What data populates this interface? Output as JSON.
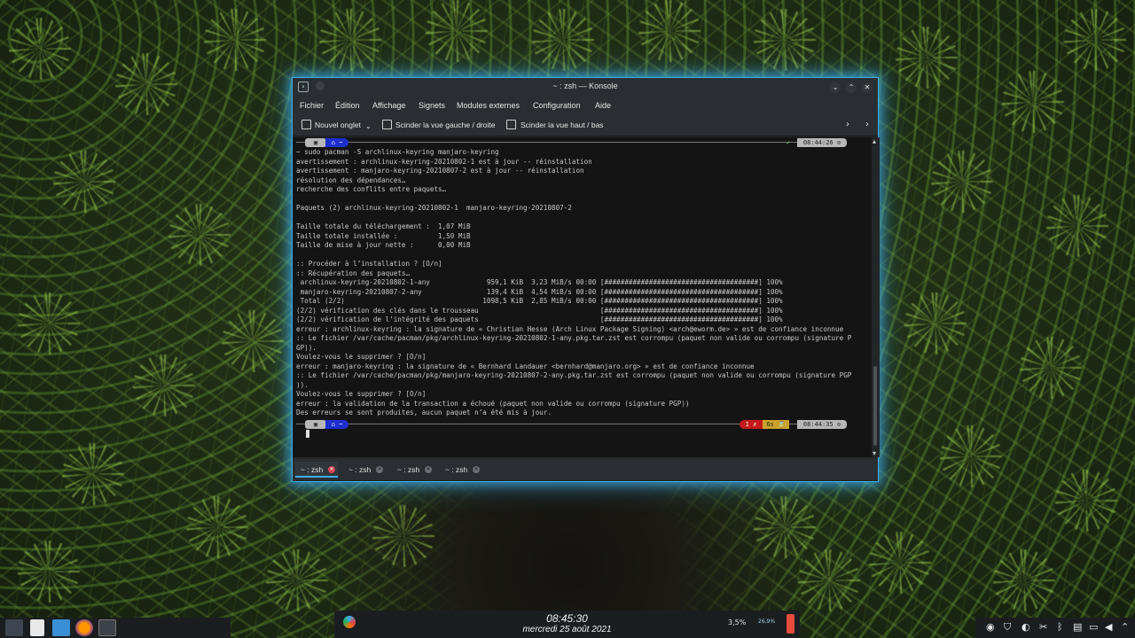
{
  "window": {
    "title": "~ : zsh — Konsole",
    "accent": "#3daee9"
  },
  "menubar": {
    "items": [
      "Fichier",
      "Édition",
      "Affichage",
      "Signets",
      "Modules externes",
      "Configuration",
      "Aide"
    ]
  },
  "toolbar": {
    "new_tab": "Nouvel onglet",
    "split_lr": "Scinder la vue gauche / droite",
    "split_tb": "Scinder la vue haut / bas"
  },
  "terminal": {
    "prompt_top": {
      "icon": "▣",
      "path": "⌂ ~",
      "check": "✓",
      "time": "08:44:26 ⊙"
    },
    "lines": [
      "~ sudo pacman -S archlinux-keyring manjaro-keyring",
      "avertissement : archlinux-keyring-20210802-1 est à jour -- réinstallation",
      "avertissement : manjaro-keyring-20210807-2 est à jour -- réinstallation",
      "résolution des dépendances…",
      "recherche des conflits entre paquets…",
      "",
      "Paquets (2) archlinux-keyring-20210802-1  manjaro-keyring-20210807-2",
      "",
      "Taille totale du téléchargement :  1,07 MiB",
      "Taille totale installée :          1,50 MiB",
      "Taille de mise à jour nette :      0,00 MiB",
      "",
      ":: Procéder à l’installation ? [O/n]",
      ":: Récupération des paquets…",
      " archlinux-keyring-20210802-1-any              959,1 KiB  3,23 MiB/s 00:00 [######################################] 100%",
      " manjaro-keyring-20210807-2-any                139,4 KiB  4,54 MiB/s 00:00 [######################################] 100%",
      " Total (2/2)                                  1098,5 KiB  2,85 MiB/s 00:00 [######################################] 100%",
      "(2/2) vérification des clés dans le trousseau                              [######################################] 100%",
      "(2/2) vérification de l’intégrité des paquets                              [######################################] 100%",
      "erreur : archlinux-keyring : la signature de « Christian Hesse (Arch Linux Package Signing) <arch@eworm.de> » est de confiance inconnue",
      ":: Le fichier /var/cache/pacman/pkg/archlinux-keyring-20210802-1-any.pkg.tar.zst est corrompu (paquet non valide ou corrompu (signature P",
      "GP)).",
      "Voulez-vous le supprimer ? [O/n]",
      "erreur : manjaro-keyring : la signature de « Bernhard Landauer <bernhard@manjaro.org> » est de confiance inconnue",
      ":: Le fichier /var/cache/pacman/pkg/manjaro-keyring-20210807-2-any.pkg.tar.zst est corrompu (paquet non valide ou corrompu (signature PGP",
      ")).",
      "Voulez-vous le supprimer ? [O/n]",
      "erreur : la validation de la transaction a échoué (paquet non valide ou corrompu (signature PGP))",
      "Des erreurs se sont produites, aucun paquet n’a été mis à jour."
    ],
    "prompt_bottom": {
      "icon": "▣",
      "path": "⌂ ~",
      "err": "1 ✗",
      "dur": "6s ⌛",
      "time": "08:44:35 ⊙"
    }
  },
  "tabs": [
    "~ : zsh",
    "~ : zsh",
    "~ : zsh",
    "~ : zsh"
  ],
  "taskbar": {
    "time": "08:45:30",
    "date": "mercredi 25 août 2021",
    "cpu": "3,5%",
    "mem": "26,9%"
  },
  "colors": {
    "terminal_bg": "#141414",
    "prompt_blue": "#1d2fcf",
    "prompt_red": "#c51b1b",
    "prompt_yellow": "#c9a22c",
    "close_red": "#da4453"
  }
}
